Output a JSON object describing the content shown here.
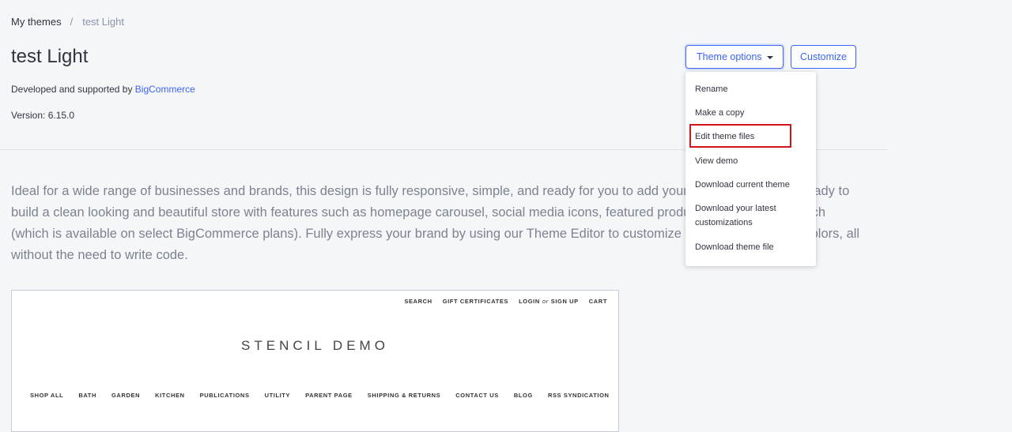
{
  "breadcrumb": {
    "parent": "My themes",
    "separator": "/",
    "current": "test Light"
  },
  "title": "test Light",
  "developed": {
    "prefix": "Developed and supported by",
    "link": "BigCommerce"
  },
  "version": "Version: 6.15.0",
  "buttons": {
    "theme_options": "Theme options",
    "customize": "Customize"
  },
  "menu": {
    "items": [
      "Rename",
      "Make a copy",
      "Edit theme files",
      "View demo",
      "Download current theme",
      "Download your latest customizations",
      "Download theme file"
    ],
    "highlighted": "Edit theme files"
  },
  "description": "Ideal for a wide range of businesses and brands, this design is fully responsive, simple, and ready for you to add your branding. It comes ready to build a clean looking and beautiful store with features such as homepage carousel, social media icons, featured products, and faceted search (which is available on select BigCommerce plans). Fully express your brand by using our Theme Editor to customize your site's fonts and colors, all without the need to write code.",
  "preview": {
    "top_links": [
      "SEARCH",
      "GIFT CERTIFICATES",
      "LOGIN",
      "or",
      "SIGN UP",
      "CART"
    ],
    "store_title": "STENCIL DEMO",
    "nav": [
      "SHOP ALL",
      "BATH",
      "GARDEN",
      "KITCHEN",
      "PUBLICATIONS",
      "UTILITY",
      "PARENT PAGE",
      "SHIPPING & RETURNS",
      "CONTACT US",
      "BLOG",
      "RSS SYNDICATION"
    ]
  },
  "colors": {
    "accent": "#3c64f4",
    "highlight_border": "#d0161b",
    "background": "#f5f6f8"
  }
}
